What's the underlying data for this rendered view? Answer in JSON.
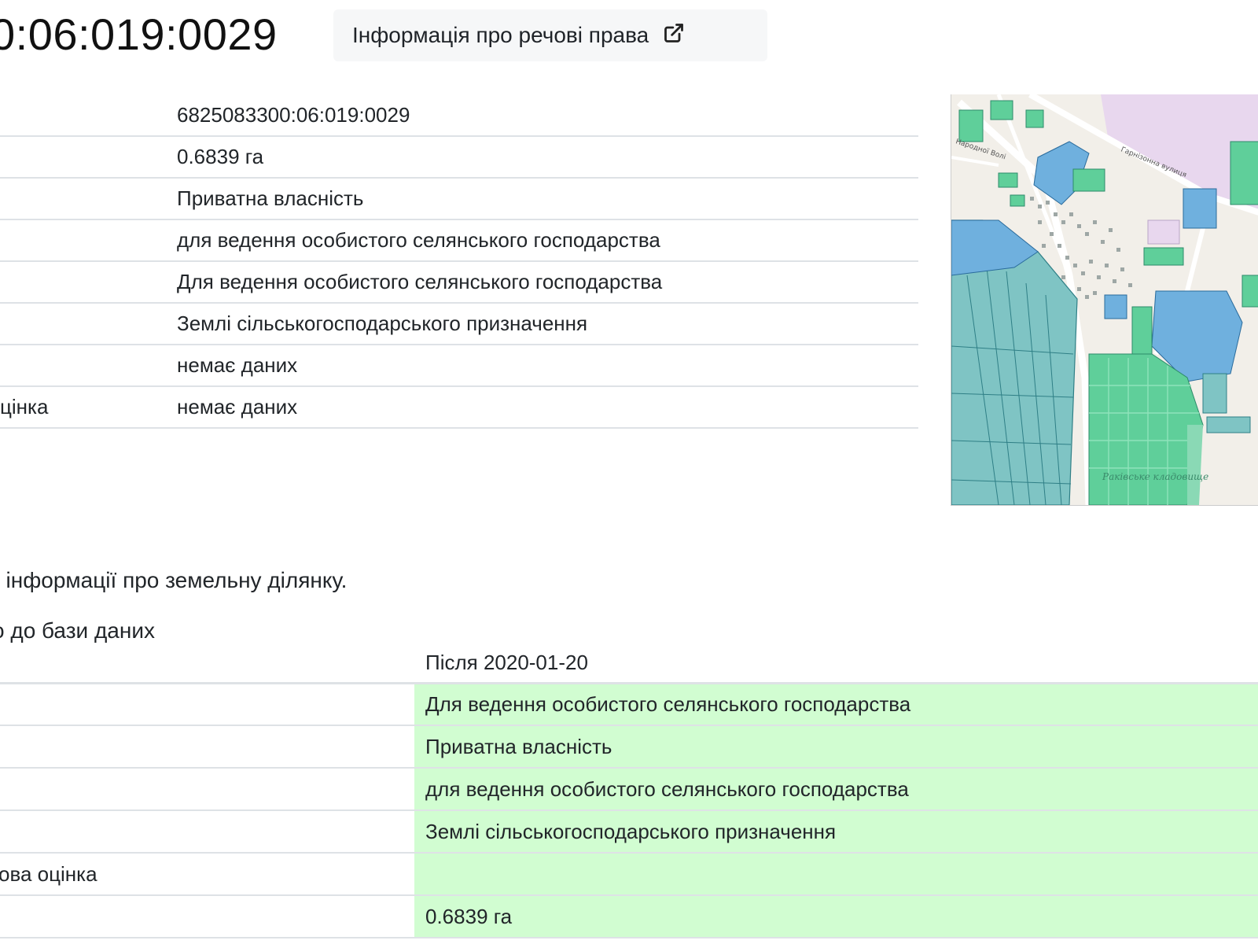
{
  "header": {
    "cadastral_fragment": "0:06:019:0029",
    "rights_button_label": "Інформація про речові права",
    "rights_button_icon": "external-link-icon"
  },
  "info_table": [
    {
      "label": "",
      "value": "6825083300:06:019:0029"
    },
    {
      "label": "",
      "value": "0.6839 га"
    },
    {
      "label": "",
      "value": "Приватна власність"
    },
    {
      "label": "",
      "value": "для ведення особистого селянського господарства"
    },
    {
      "label": "",
      "value": "Для ведення особистого селянського господарства"
    },
    {
      "label": "",
      "value": "Землі сільськогосподарського призначення"
    },
    {
      "label": "",
      "value": "немає даних"
    },
    {
      "label": "цінка",
      "value": "немає даних"
    }
  ],
  "map": {
    "labels": [
      "Гарнізонна вулиця",
      "Народної Волі",
      "Раківське кладовище"
    ],
    "colors": {
      "base": "#f2efe9",
      "parcel_teal": "#7fc4c4",
      "parcel_green": "#5fcf9a",
      "parcel_blue": "#6fb0de",
      "military": "#e8d7ee"
    }
  },
  "note_text": "/ інформації про земельну ділянку.",
  "history": {
    "caption": "о до бази даних",
    "header_after": "Після 2020-01-20",
    "rows": [
      {
        "label": "",
        "value": "Для ведення особистого селянського господарства"
      },
      {
        "label": "",
        "value": "Приватна власність"
      },
      {
        "label": "",
        "value": "для ведення особистого селянського господарства"
      },
      {
        "label": "",
        "value": "Землі сільськогосподарського призначення"
      },
      {
        "label": "ова оцінка",
        "value": ""
      },
      {
        "label": "",
        "value": "0.6839 га"
      }
    ]
  }
}
